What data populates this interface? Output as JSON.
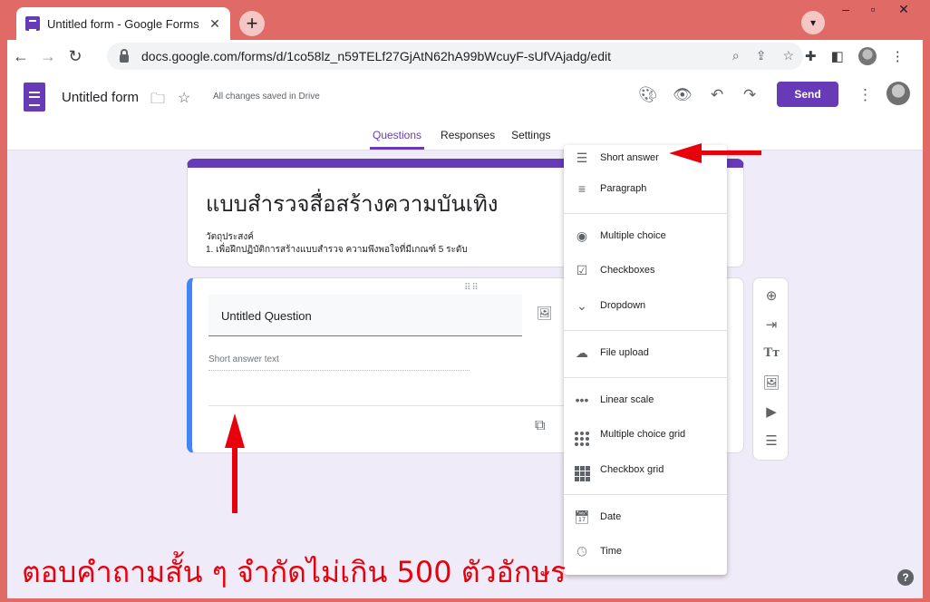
{
  "browser": {
    "tab_title": "Untitled form - Google Forms",
    "tab_close": "✕",
    "new_tab": "+",
    "url": "docs.google.com/forms/d/1co58lz_n59TELf27GjAtN62hA99bWcuyF-sUfVAjadg/edit"
  },
  "header": {
    "form_name": "Untitled form",
    "saved_status": "All changes saved in Drive",
    "send_label": "Send",
    "tabs": [
      "Questions",
      "Responses",
      "Settings"
    ]
  },
  "form": {
    "title": "แบบสำรวจสื่อสร้างความบันเทิง",
    "desc_line1": "วัตถุประสงค์",
    "desc_line2": "1. เพื่อฝึกปฏิบัติการสร้างแบบสำรวจ ความพึงพอใจที่มีเกณฑ์ 5 ระดับ"
  },
  "question": {
    "title": "Untitled Question",
    "answer_placeholder": "Short answer text"
  },
  "menu": {
    "items": [
      {
        "label": "Short answer",
        "icon": "short-text-icon"
      },
      {
        "label": "Paragraph",
        "icon": "paragraph-icon"
      },
      {
        "label": "Multiple choice",
        "icon": "radio-icon"
      },
      {
        "label": "Checkboxes",
        "icon": "checkbox-icon"
      },
      {
        "label": "Dropdown",
        "icon": "dropdown-icon"
      },
      {
        "label": "File upload",
        "icon": "cloud-upload-icon"
      },
      {
        "label": "Linear scale",
        "icon": "linear-scale-icon"
      },
      {
        "label": "Multiple choice grid",
        "icon": "dot-grid-icon"
      },
      {
        "label": "Checkbox grid",
        "icon": "checkbox-grid-icon"
      },
      {
        "label": "Date",
        "icon": "calendar-icon"
      },
      {
        "label": "Time",
        "icon": "clock-icon"
      }
    ]
  },
  "annotation": {
    "text": "ตอบคำถามสั้น ๆ จำกัดไม่เกิน 500 ตัวอักษร"
  },
  "colors": {
    "accent": "#673ab7",
    "question_border": "#4285f4",
    "annotation": "#e8000b",
    "window_frame": "#e06a66"
  }
}
